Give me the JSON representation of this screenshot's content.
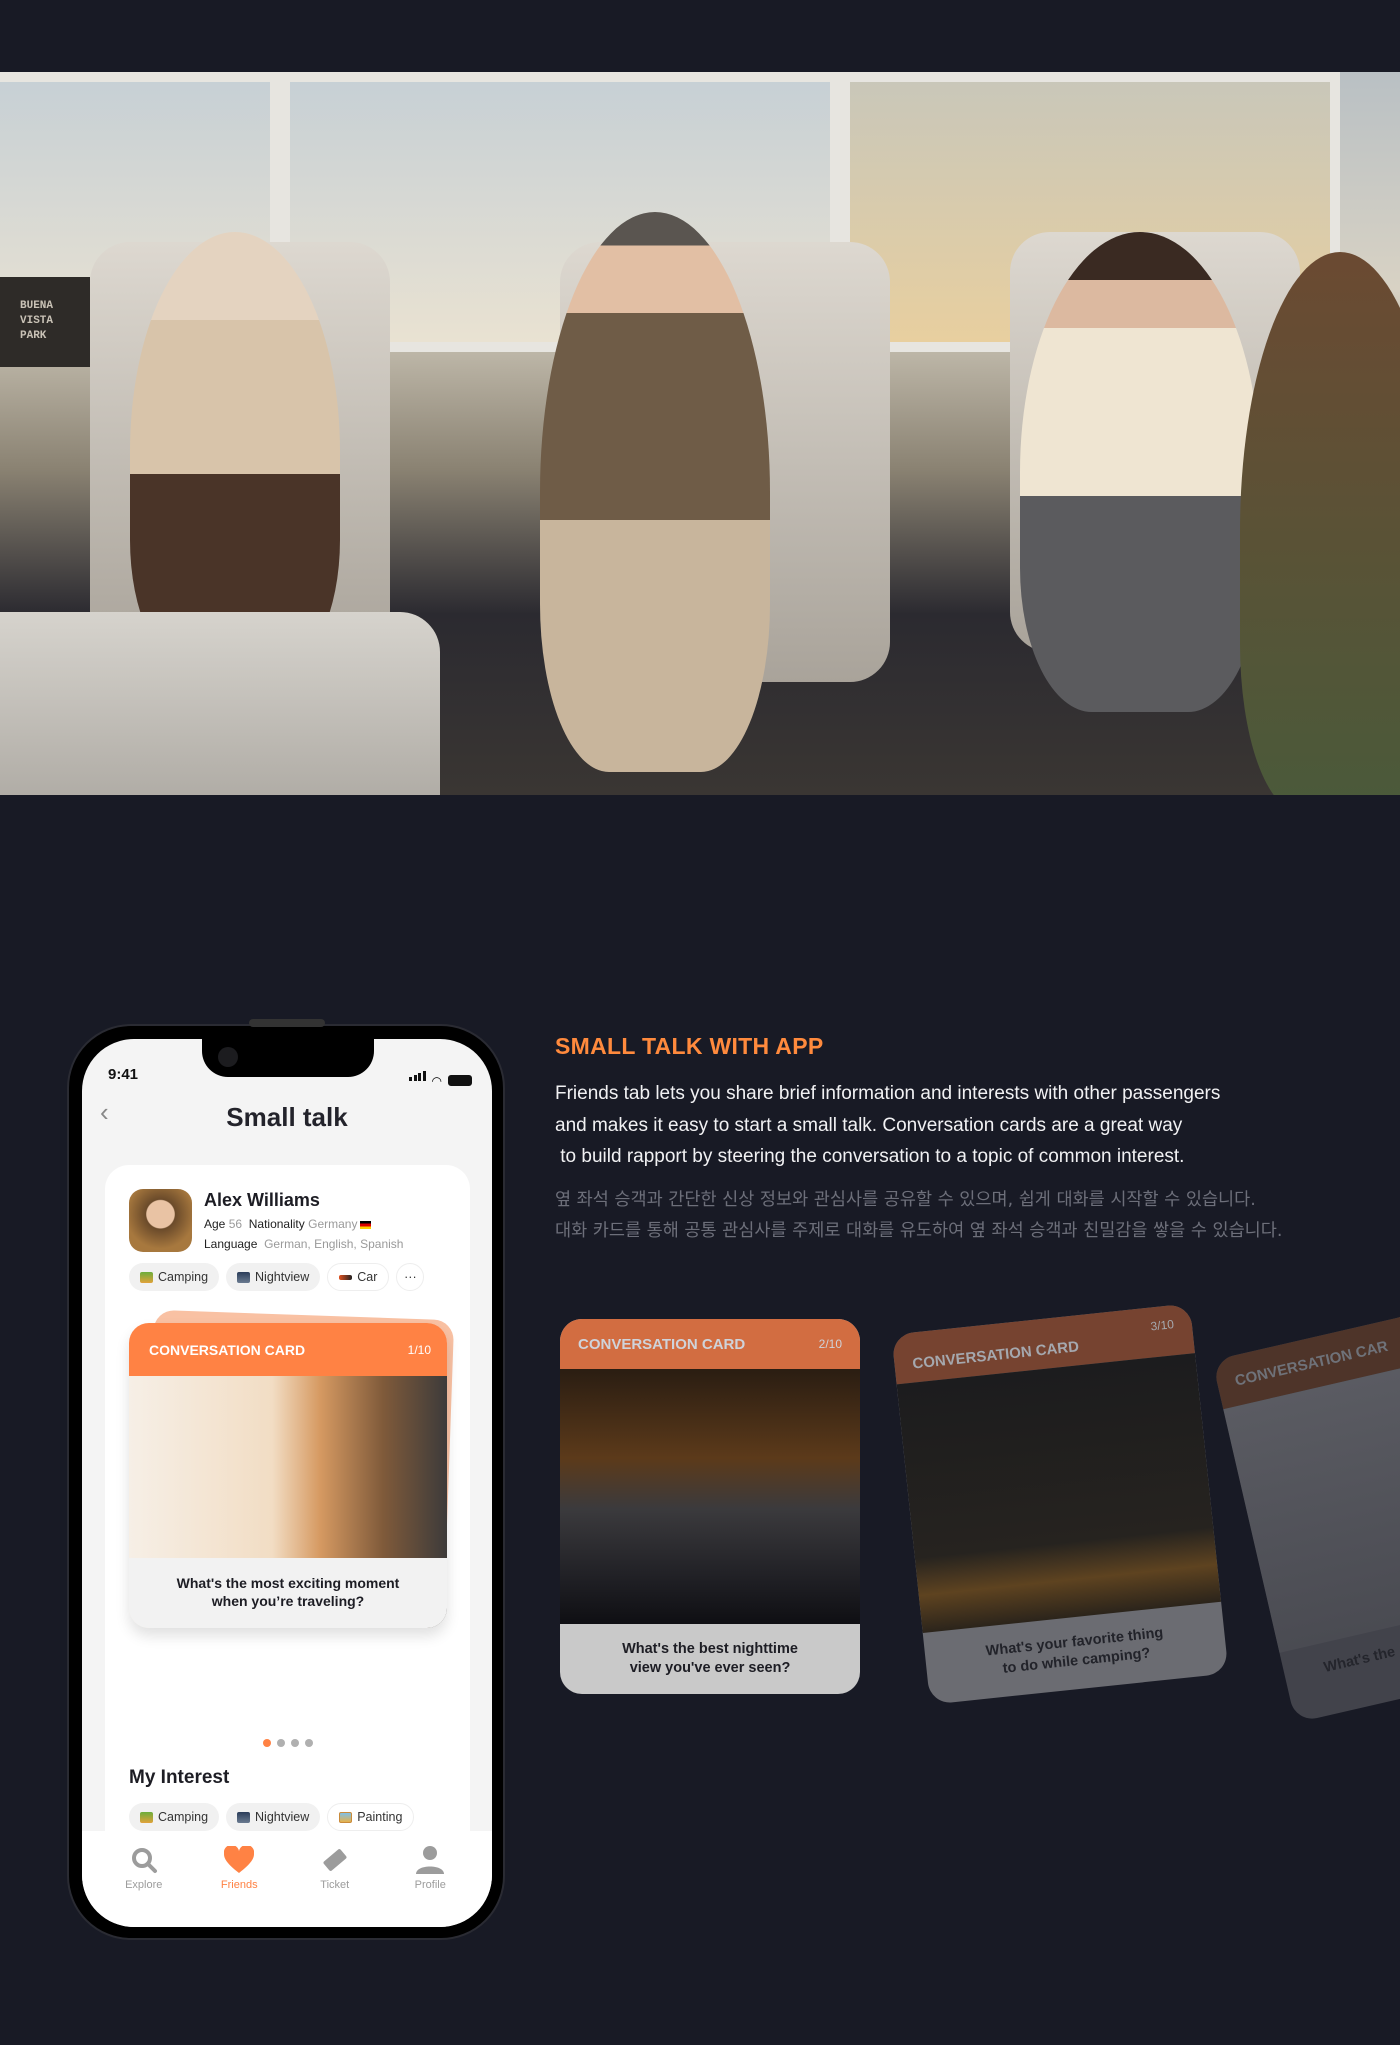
{
  "hero": {
    "sign_text": "BUENA VISTA PARK"
  },
  "section": {
    "title": "SMALL TALK WITH APP",
    "paragraph_lines": [
      "Friends tab lets you share brief information and interests with other passengers",
      "and makes it easy to start a small talk. Conversation cards are a great way",
      " to build rapport by steering the conversation to a topic of common interest."
    ],
    "korean_lines": [
      "옆 좌석 승객과 간단한 신상 정보와 관심사를 공유할 수 있으며, 쉽게 대화를 시작할 수 있습니다.",
      "대화 카드를 통해 공통 관심사를 주제로 대화를 유도하여 옆 좌석 승객과 친밀감을 쌓을 수 있습니다."
    ]
  },
  "phone": {
    "time": "9:41",
    "title": "Small talk",
    "profile": {
      "name": "Alex Williams",
      "age_label": "Age",
      "age": "56",
      "nationality_label": "Nationality",
      "nationality": "Germany",
      "language_label": "Language",
      "languages": "German, English, Spanish",
      "tags": [
        {
          "label": "Camping",
          "icon": "camping-icon"
        },
        {
          "label": "Nightview",
          "icon": "nightview-icon"
        },
        {
          "label": "Car",
          "icon": "car-icon"
        }
      ],
      "more": "···"
    },
    "conversation_card": {
      "label": "CONVERSATION CARD",
      "counter": "1/10",
      "question_lines": [
        "What's the most exciting moment",
        "when you’re traveling?"
      ]
    },
    "pagination": {
      "total": 4,
      "active": 1
    },
    "my_interest": {
      "title": "My Interest",
      "tags": [
        {
          "label": "Camping",
          "icon": "camping-icon"
        },
        {
          "label": "Nightview",
          "icon": "nightview-icon"
        },
        {
          "label": "Painting",
          "icon": "painting-icon"
        }
      ]
    },
    "nav": [
      {
        "label": "Explore",
        "icon": "search-icon"
      },
      {
        "label": "Friends",
        "icon": "heart-icon",
        "active": true
      },
      {
        "label": "Ticket",
        "icon": "ticket-icon"
      },
      {
        "label": "Profile",
        "icon": "person-icon"
      }
    ]
  },
  "cards": [
    {
      "label": "CONVERSATION CARD",
      "counter": "2/10",
      "question_lines": [
        "What's the best nighttime",
        "view you've ever seen?"
      ]
    },
    {
      "label": "CONVERSATION CARD",
      "counter": "3/10",
      "question_lines": [
        "What's your favorite thing",
        "to do while camping?"
      ]
    },
    {
      "label": "CONVERSATION CAR",
      "question_lines": [
        "What's the"
      ]
    }
  ],
  "colors": {
    "accent": "#ff8244",
    "background": "#181a25",
    "title": "#ff8a3d"
  }
}
